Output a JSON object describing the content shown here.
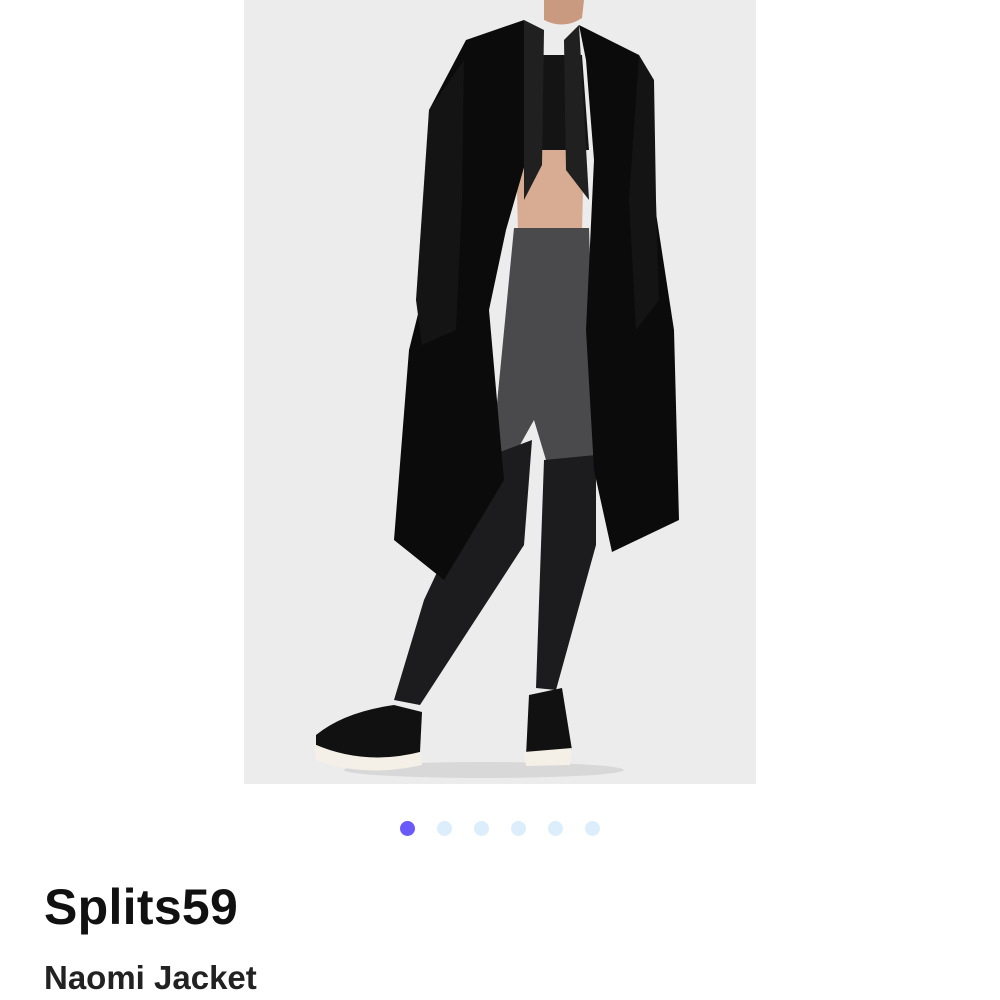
{
  "product": {
    "brand": "Splits59",
    "name": "Naomi Jacket",
    "image": {
      "subject": "product-photo",
      "background_color": "#ececec"
    }
  },
  "carousel": {
    "count": 6,
    "active_index": 0,
    "active_color": "#6a5af9",
    "inactive_color": "#dceefb"
  }
}
